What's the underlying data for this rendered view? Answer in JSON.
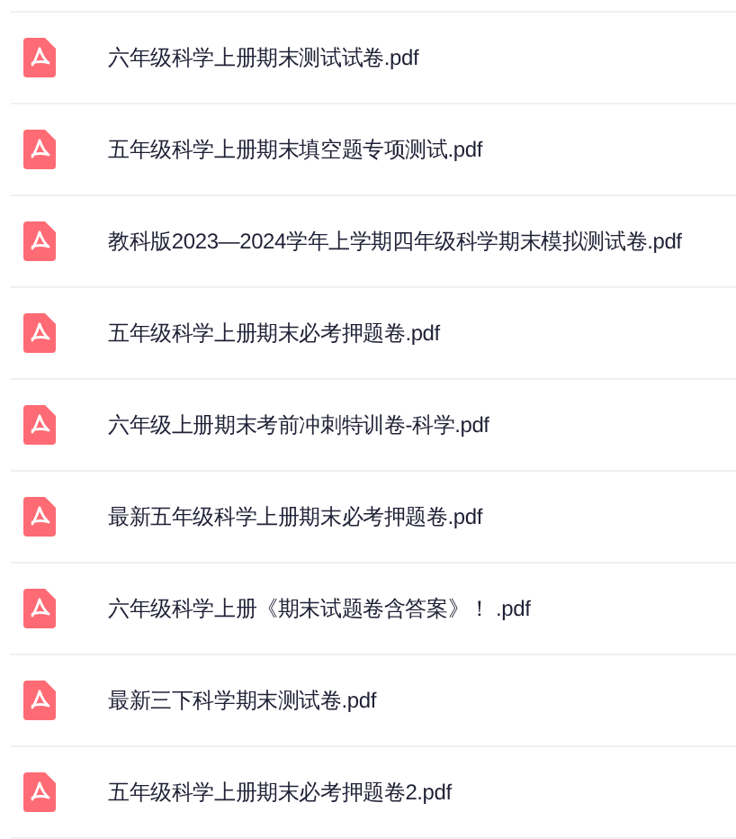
{
  "files": [
    {
      "name": "六年级科学上册期末测试试卷.pdf"
    },
    {
      "name": "五年级科学上册期末填空题专项测试.pdf"
    },
    {
      "name": "教科版2023—2024学年上学期四年级科学期末模拟测试卷.pdf"
    },
    {
      "name": "五年级科学上册期末必考押题卷.pdf"
    },
    {
      "name": "六年级上册期末考前冲刺特训卷-科学.pdf"
    },
    {
      "name": "最新五年级科学上册期末必考押题卷.pdf"
    },
    {
      "name": "六年级科学上册《期末试题卷含答案》！ .pdf"
    },
    {
      "name": "最新三下科学期末测试卷.pdf"
    },
    {
      "name": "五年级科学上册期末必考押题卷2.pdf"
    }
  ]
}
